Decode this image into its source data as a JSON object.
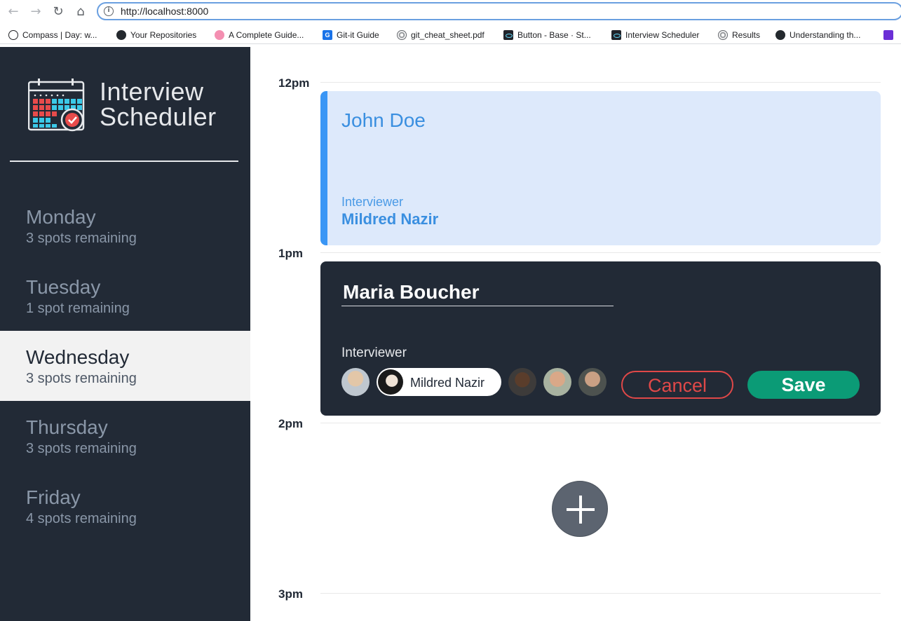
{
  "browser": {
    "url": "http://localhost:8000",
    "back_icon": "←",
    "forward_icon": "→",
    "reload_icon": "↻",
    "home_icon": "⌂",
    "info_icon": "i",
    "bookmarks": [
      {
        "label": "Compass | Day: w...",
        "icon": "compass-icon"
      },
      {
        "label": "Your Repositories",
        "icon": "github-icon"
      },
      {
        "label": "A Complete Guide...",
        "icon": "pink-dot-icon"
      },
      {
        "label": "Git-it Guide",
        "icon": "g-icon"
      },
      {
        "label": "git_cheat_sheet.pdf",
        "icon": "globe-icon"
      },
      {
        "label": "Button - Base · St...",
        "icon": "react-icon"
      },
      {
        "label": "Interview Scheduler",
        "icon": "react-icon"
      },
      {
        "label": "Results",
        "icon": "globe-icon"
      },
      {
        "label": "Understanding th...",
        "icon": "github-icon"
      },
      {
        "label": "",
        "icon": "mail-icon"
      }
    ]
  },
  "sidebar": {
    "brand_line1": "Interview",
    "brand_line2": "Scheduler",
    "days": [
      {
        "name": "Monday",
        "spots": "3 spots remaining",
        "selected": false
      },
      {
        "name": "Tuesday",
        "spots": "1 spot remaining",
        "selected": false
      },
      {
        "name": "Wednesday",
        "spots": "3 spots remaining",
        "selected": true
      },
      {
        "name": "Thursday",
        "spots": "3 spots remaining",
        "selected": false
      },
      {
        "name": "Friday",
        "spots": "4 spots remaining",
        "selected": false
      }
    ]
  },
  "schedule": {
    "times": [
      "12pm",
      "1pm",
      "2pm",
      "3pm"
    ],
    "appointment_show": {
      "student": "John Doe",
      "interviewer_label": "Interviewer",
      "interviewer_name": "Mildred Nazir"
    },
    "appointment_form": {
      "student_value": "Maria Boucher",
      "interviewer_label": "Interviewer",
      "selected_interviewer": "Mildred Nazir",
      "cancel_label": "Cancel",
      "save_label": "Save"
    },
    "add_icon": "plus-icon"
  },
  "colors": {
    "sidebar_bg": "#222a36",
    "accent_blue": "#3a96f5",
    "save_green": "#0b9b76",
    "cancel_red": "#e04848"
  }
}
